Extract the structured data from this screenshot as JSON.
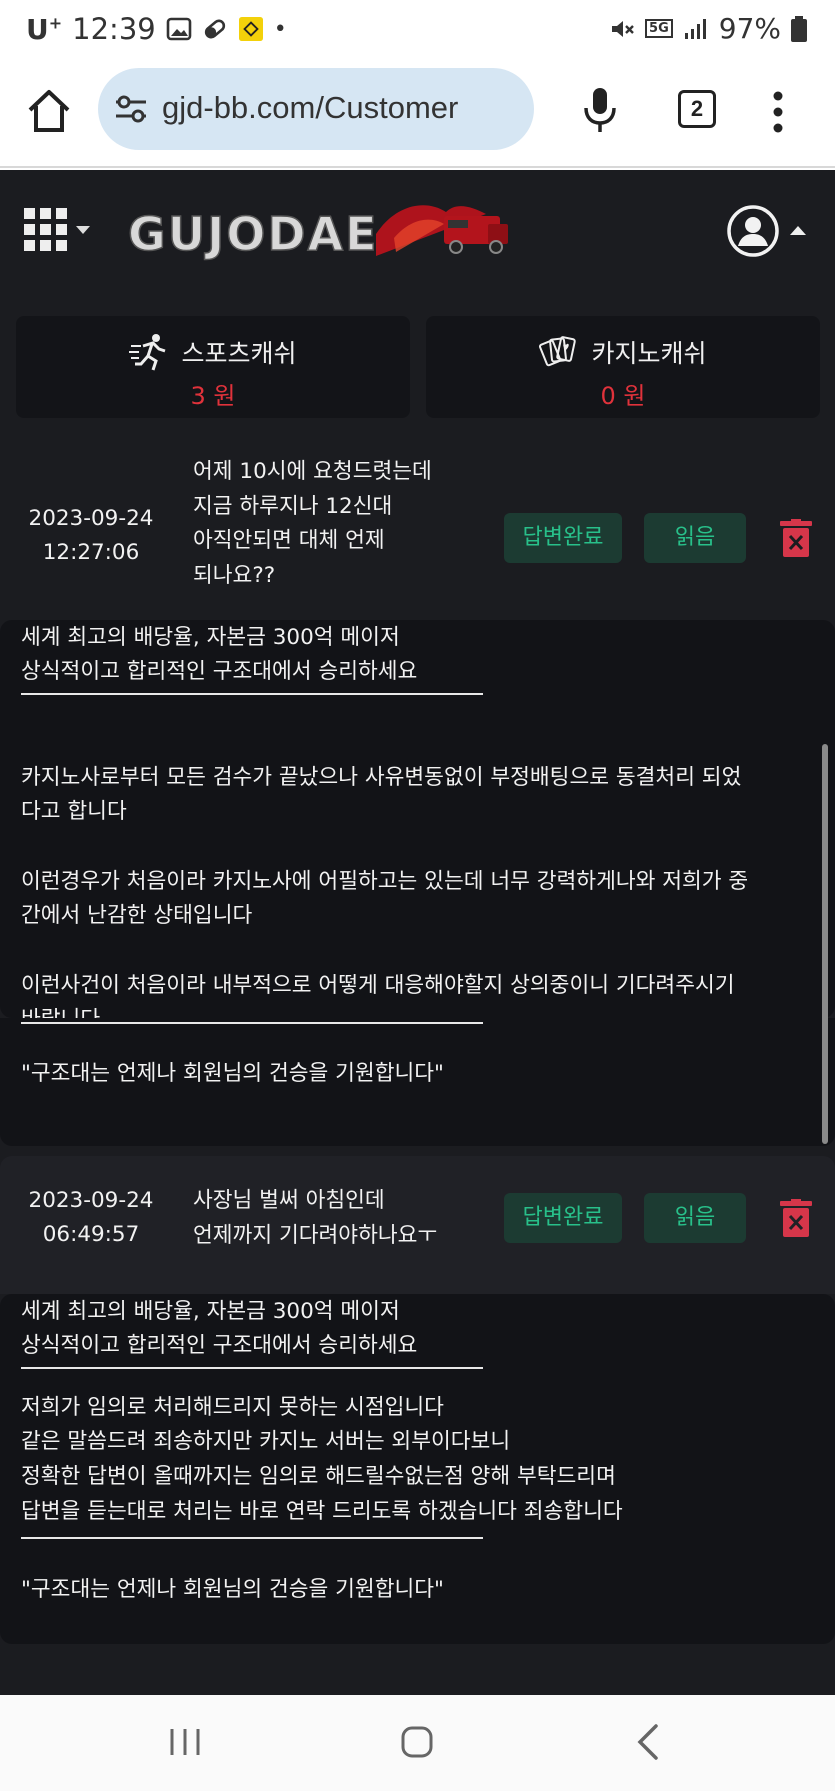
{
  "status_bar": {
    "carrier": "U",
    "carrier_sup": "+",
    "time": "12:39",
    "network": "5G",
    "battery": "97%"
  },
  "browser": {
    "url": "gjd-bb.com/Customer",
    "tab_count": "2"
  },
  "site": {
    "logo_text": "GUJODAE"
  },
  "cash": {
    "sports": {
      "label": "스포츠캐쉬",
      "value": "3 원"
    },
    "casino": {
      "label": "카지노캐쉬",
      "value": "0 원"
    }
  },
  "inquiries": [
    {
      "date": "2023-09-24",
      "time": "12:27:06",
      "question": [
        "어제 10시에 요청드렷는데",
        "지금 하루지나 12신대",
        "아직안되면 대체 언제",
        "되나요??"
      ],
      "status": "답변완료",
      "read": "읽음",
      "answer": {
        "header": [
          "세계 최고의 배당율, 자본금 300억 메이저",
          "상식적이고 합리적인 구조대에서 승리하세요"
        ],
        "body": [
          "카지노사로부터 모든 검수가 끝났으나 사유변동없이 부정배팅으로 동결처리 되었",
          "다고 합니다",
          "",
          "이런경우가 처음이라 카지노사에 어필하고는 있는데 너무 강력하게나와 저희가 중",
          "간에서 난감한 상태입니다",
          "",
          "이런사건이 처음이라 내부적으로 어떻게 대응해야할지 상의중이니 기다려주시기",
          "바랍니다"
        ],
        "footer": "\"구조대는 언제나 회원님의 건승을 기원합니다\""
      }
    },
    {
      "date": "2023-09-24",
      "time": "06:49:57",
      "question": [
        "사장님 벌써 아침인데",
        "언제까지 기다려야하나요ㅜ"
      ],
      "status": "답변완료",
      "read": "읽음",
      "answer": {
        "header": [
          "세계 최고의 배당율, 자본금 300억 메이저",
          "상식적이고 합리적인 구조대에서 승리하세요"
        ],
        "body": [
          "저희가 임의로 처리해드리지 못하는 시점입니다",
          "같은 말씀드려 죄송하지만 카지노 서버는 외부이다보니",
          "정확한 답변이 올때까지는 임의로 해드릴수없는점 양해 부탁드리며",
          "답변을 듣는대로 처리는 바로 연락 드리도록 하겠습니다 죄송합니다"
        ],
        "footer": "\"구조대는 언제나 회원님의 건승을 기원합니다\""
      }
    }
  ],
  "icons": {
    "home": "home-icon",
    "site_settings": "tune-icon",
    "mic": "mic-icon",
    "menu": "more-vert-icon",
    "grid": "grid-menu-icon",
    "user": "user-avatar-icon",
    "sports": "running-person-icon",
    "casino": "playing-cards-icon",
    "delete": "trash-icon"
  },
  "colors": {
    "page_bg": "#1b1c20",
    "answer_bg": "#121317",
    "accent_red": "#e0323b",
    "status_green": "#28c08a",
    "status_btn_bg": "#1c3b32",
    "url_bar_bg": "#d6e6f3"
  }
}
